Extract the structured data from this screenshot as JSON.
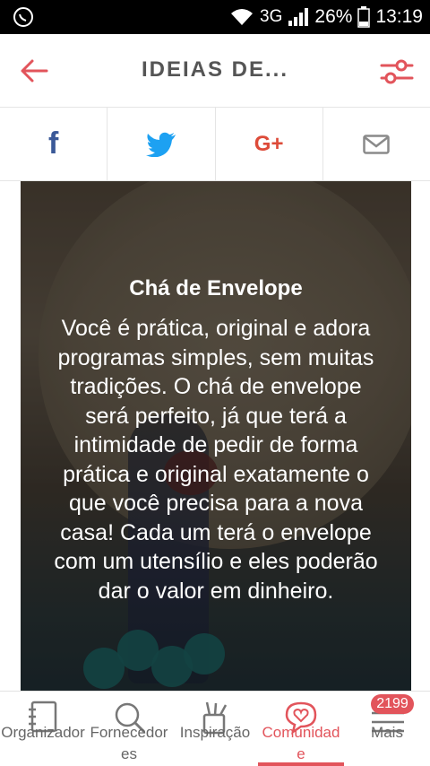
{
  "status_bar": {
    "network": "3G",
    "battery": "26%",
    "time": "13:19"
  },
  "header": {
    "title": "IDEIAS DE..."
  },
  "share": {
    "facebook": "f",
    "gplus": "G+"
  },
  "card": {
    "title": "Chá de Envelope",
    "text": "Você é prática, original e adora programas simples, sem muitas tradições. O chá de envelope será perfeito, já que terá a intimidade de pedir de forma prática e original exatamente o que você precisa para a nova casa! Cada um terá o envelope com um utensílio e eles poderão dar o valor em dinheiro."
  },
  "bottom_nav": {
    "items": [
      {
        "label": "Organizador"
      },
      {
        "label": "Fornecedores"
      },
      {
        "label": "Inspiração"
      },
      {
        "label": "Comunidade"
      },
      {
        "label": "Mais"
      }
    ],
    "badge": "2199"
  },
  "colors": {
    "accent": "#e2545b",
    "facebook": "#3b5998",
    "twitter": "#1da1f2",
    "gplus": "#dd4b39"
  }
}
